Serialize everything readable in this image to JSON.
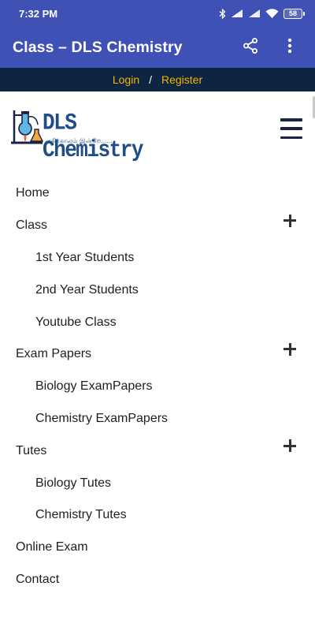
{
  "status_bar": {
    "time": "7:32 PM",
    "battery": "58"
  },
  "app_bar": {
    "title": "Class – DLS Chemistry"
  },
  "auth": {
    "login": "Login",
    "separator": "/",
    "register": "Register"
  },
  "logo": {
    "title": "DLS Chemistry",
    "tagline": "எதிர்காலம் இன்றே......"
  },
  "menu": {
    "home": "Home",
    "class": "Class",
    "class_sub": [
      "1st Year Students",
      "2nd Year Students",
      "Youtube Class"
    ],
    "exam_papers": "Exam Papers",
    "exam_papers_sub": [
      "Biology ExamPapers",
      "Chemistry ExamPapers"
    ],
    "tutes": "Tutes",
    "tutes_sub": [
      "Biology Tutes",
      "Chemistry Tutes"
    ],
    "online_exam": "Online Exam",
    "contact": "Contact"
  },
  "colors": {
    "app_bar": "#3f51b5",
    "login_strip": "#0d2540",
    "auth_link": "#f5b400",
    "logo_text": "#1f4e86"
  },
  "icons": [
    "bluetooth-icon",
    "signal-icon",
    "wifi-icon",
    "battery-icon",
    "share-icon",
    "more-vert-icon",
    "menu-icon",
    "plus-icon"
  ]
}
